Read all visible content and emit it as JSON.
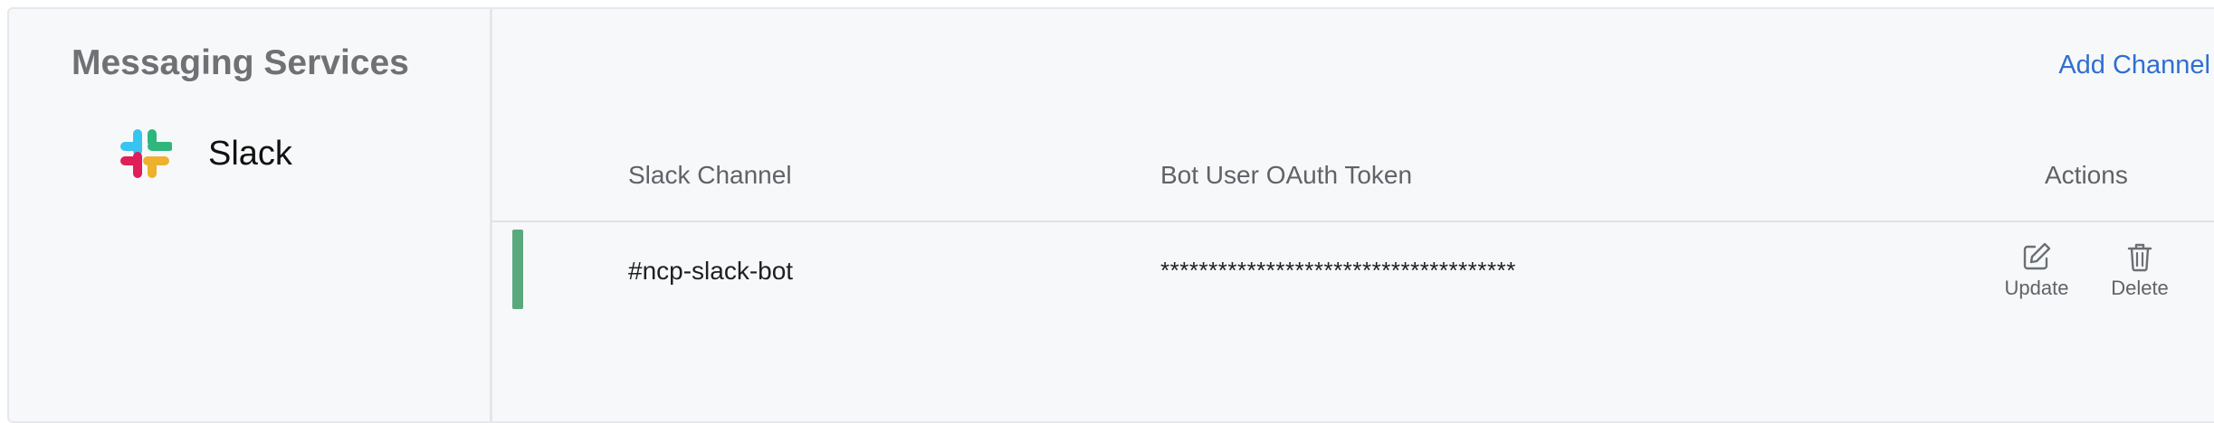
{
  "sidebar": {
    "title": "Messaging Services",
    "items": [
      {
        "label": "Slack",
        "icon": "slack-logo-icon"
      }
    ]
  },
  "toolbar": {
    "add_channel_label": "Add Channel"
  },
  "table": {
    "columns": [
      "Slack Channel",
      "Bot User OAuth Token",
      "Actions"
    ],
    "rows": [
      {
        "channel": "#ncp-slack-bot",
        "token": "*************************************",
        "status_color": "#5aa97e"
      }
    ],
    "actions": {
      "update_label": "Update",
      "update_icon": "edit-icon",
      "delete_label": "Delete",
      "delete_icon": "trash-icon"
    }
  },
  "colors": {
    "accent": "#2f6fcf",
    "slack_blue": "#36c5f0",
    "slack_green": "#2eb67d",
    "slack_red": "#e01e5a",
    "slack_yellow": "#ecb22e"
  }
}
